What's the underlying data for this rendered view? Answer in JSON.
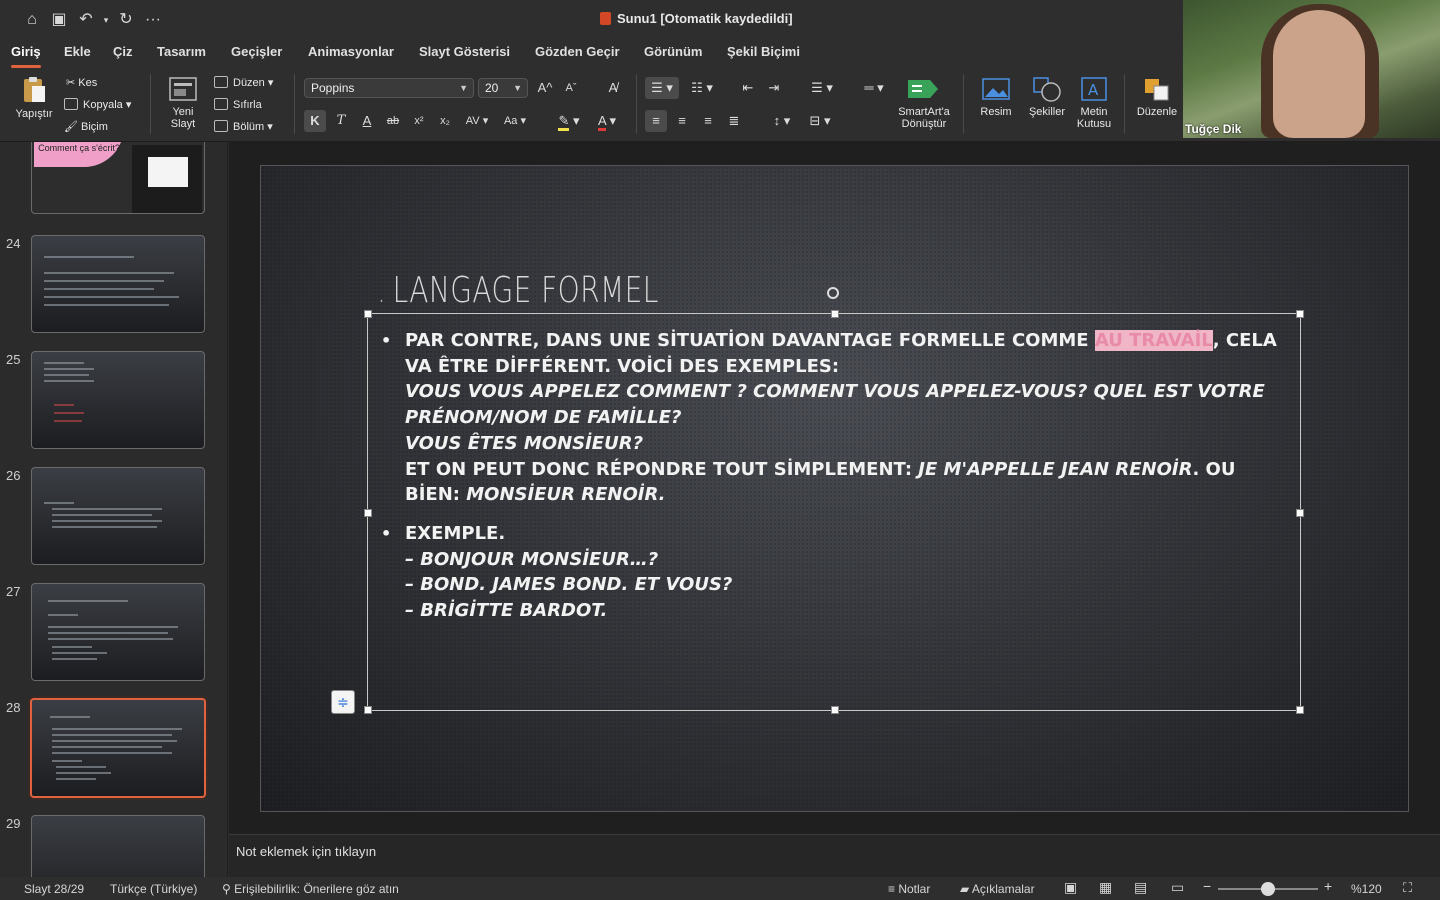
{
  "window": {
    "title": "Sunu1 [Otomatik kaydedildi]"
  },
  "quick_access": {
    "home": "⌂",
    "save": "💾",
    "undo": "↶",
    "redo": "↻",
    "more": "···"
  },
  "tabs": [
    "Giriş",
    "Ekle",
    "Çiz",
    "Tasarım",
    "Geçişler",
    "Animasyonlar",
    "Slayt Gösterisi",
    "Gözden Geçir",
    "Görünüm",
    "Şekil Biçimi"
  ],
  "ribbon": {
    "paste": "Yapıştır",
    "cut": "Kes",
    "copy": "Kopyala",
    "format": "Biçim",
    "new_slide": "Yeni Slayt",
    "layout": "Düzen",
    "reset": "Sıfırla",
    "section": "Bölüm",
    "font_name": "Poppins",
    "font_size": "20",
    "bold": "K",
    "italic": "T",
    "underline": "A",
    "strike": "ab",
    "superscript": "x²",
    "subscript": "x₂",
    "spacing": "AV",
    "case": "Aa",
    "smartart": "SmartArt'a Dönüştür",
    "picture": "Resim",
    "shapes": "Şekiller",
    "textbox": "Metin Kutusu",
    "arrange": "Düzenle"
  },
  "webcam": {
    "name": "Tuğçe Dik"
  },
  "thumbnails": [
    {
      "num": "",
      "text": "Comment ça s'écrit?"
    },
    {
      "num": "24"
    },
    {
      "num": "25"
    },
    {
      "num": "26"
    },
    {
      "num": "27"
    },
    {
      "num": "28"
    },
    {
      "num": "29"
    }
  ],
  "slide": {
    "title": "LANGAGE FORMEL",
    "title_dot": ".",
    "p1_a": "PAR CONTRE, DANS UNE SİTUATİON DAVANTAGE FORMELLE COMME ",
    "p1_hl": "AU TRAVAİL",
    "p1_b": ", CELA VA ÊTRE DİFFÉRENT. VOİCİ DES EXEMPLES:",
    "p1_it1": "VOUS VOUS APPELEZ COMMENT ? COMMENT VOUS APPELEZ-VOUS? QUEL EST VOTRE PRÉNOM/NOM DE FAMİLLE?",
    "p1_it2": "VOUS ÊTES MONSİEUR?",
    "p1_c": "ET ON PEUT DONC RÉPONDRE TOUT SİMPLEMENT: ",
    "p1_c_it": "JE M'APPELLE JEAN RENOİR",
    "p1_d": ". OU BİEN: ",
    "p1_d_it": "MONSİEUR RENOİR.",
    "p2_a": "EXEMPLE.",
    "p2_l1": "– BONJOUR MONSİEUR…?",
    "p2_l2": "– BOND. JAMES BOND. ET VOUS?",
    "p2_l3": "– BRİGİTTE BARDOT."
  },
  "notes": {
    "placeholder": "Not eklemek için tıklayın"
  },
  "status": {
    "slide": "Slayt 28/29",
    "language": "Türkçe (Türkiye)",
    "accessibility": "Erişilebilirlik: Önerilere göz atın",
    "notes": "Notlar",
    "comments": "Açıklamalar",
    "zoom": "%120",
    "zoom_fraction": 0.5
  },
  "colors": {
    "accent": "#e0623e",
    "highlight": "#f0b6c8",
    "squiggle": "#c43a3a"
  }
}
